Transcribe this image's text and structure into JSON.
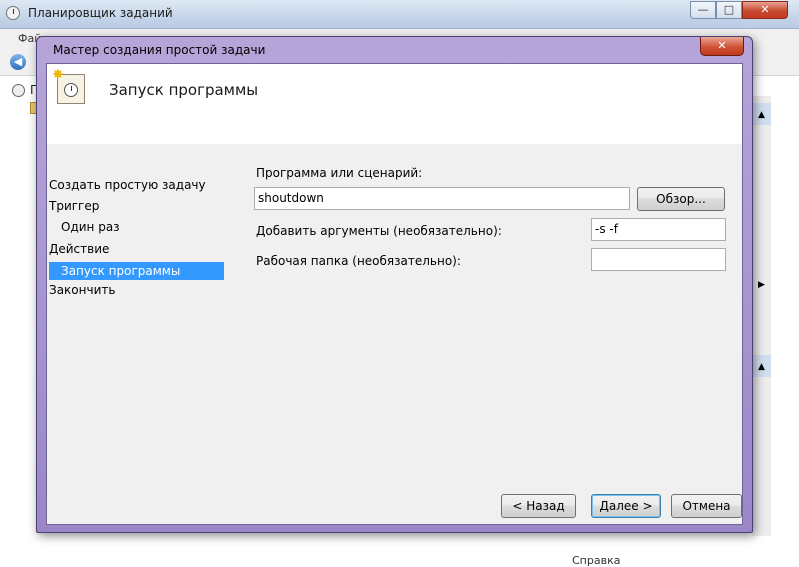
{
  "main_window": {
    "title": "Планировщик заданий",
    "menu_visible": "Файл",
    "tree_root_label": "Пл",
    "status_partial": "Справка",
    "buttons": {
      "minimize": "—",
      "maximize": "□",
      "close": "✕"
    },
    "back_icon": "arrow-left-icon"
  },
  "wizard": {
    "title": "Мастер создания простой задачи",
    "close_glyph": "✕",
    "header_title": "Запуск программы",
    "nav": {
      "create": "Создать простую задачу",
      "trigger": "Триггер",
      "once": "Один раз",
      "action": "Действие",
      "run_program": "Запуск программы",
      "finish": "Закончить"
    },
    "selected_nav": "Запуск программы",
    "selection_color": "#3399ff",
    "form": {
      "program_label": "Программа или сценарий:",
      "program_value": "shoutdown",
      "browse_label": "Обзор...",
      "args_label": "Добавить аргументы (необязательно):",
      "args_value": "-s -f",
      "workdir_label": "Рабочая папка (необязательно):",
      "workdir_value": ""
    },
    "buttons": {
      "back": "< Назад",
      "next": "Далее >",
      "cancel": "Отмена"
    }
  }
}
